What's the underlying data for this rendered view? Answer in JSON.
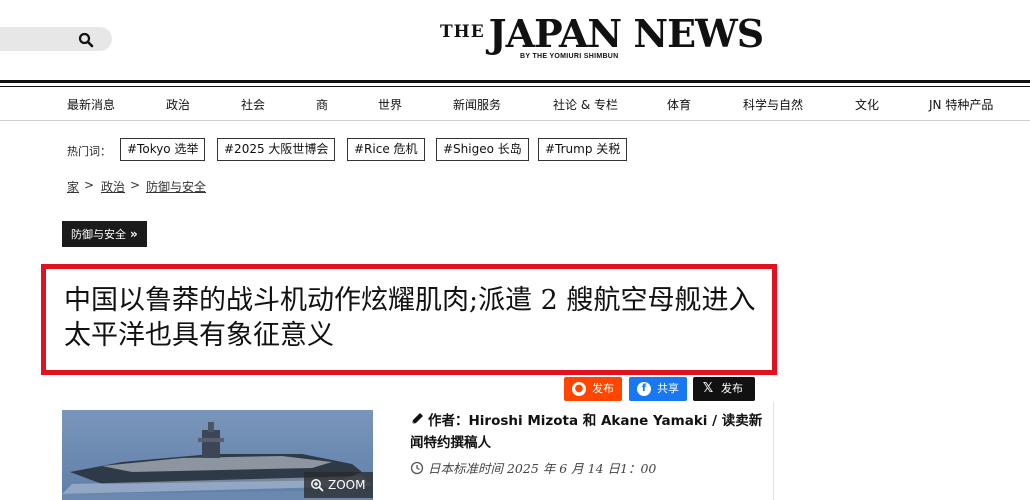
{
  "header": {
    "logo_the": "THE",
    "logo_name": "JAPAN NEWS",
    "logo_sub": "BY THE YOMIURI SHIMBUN"
  },
  "nav": {
    "items": [
      {
        "label": "最新消息"
      },
      {
        "label": "政治"
      },
      {
        "label": "社会"
      },
      {
        "label": "商"
      },
      {
        "label": "世界"
      },
      {
        "label": "新闻服务"
      },
      {
        "label": "社论 & 专栏"
      },
      {
        "label": "体育"
      },
      {
        "label": "科学与自然"
      },
      {
        "label": "文化"
      },
      {
        "label": "JN 特种产品"
      }
    ]
  },
  "hot": {
    "label": "热门词：",
    "tags": [
      "#Tokyo 选举",
      "#2025 大阪世博会",
      "#Rice 危机",
      "#Shigeo 长岛",
      "#Trump 关税"
    ]
  },
  "breadcrumb": {
    "home": "家",
    "sep": ">",
    "level1": "政治",
    "level2": "防御与安全"
  },
  "section_badge": {
    "label": "防御与安全",
    "arrow": "»"
  },
  "article": {
    "headline": "中国以鲁莽的战斗机动作炫耀肌肉;派遣 2 艘航空母舰进入太平洋也具有象征意义",
    "byline": "作者：Hiroshi Mizota 和 Akane Yamaki / 读卖新闻特约撰稿人",
    "date": "日本标准时间 2025 年 6 月 14 日1：00",
    "zoom_label": "ZOOM"
  },
  "share": {
    "reddit": "发布",
    "facebook": "共享",
    "x": "发布"
  },
  "colors": {
    "highlight_border": "#e01220",
    "reddit": "#ff4500",
    "facebook": "#1877f2",
    "x": "#111111"
  }
}
